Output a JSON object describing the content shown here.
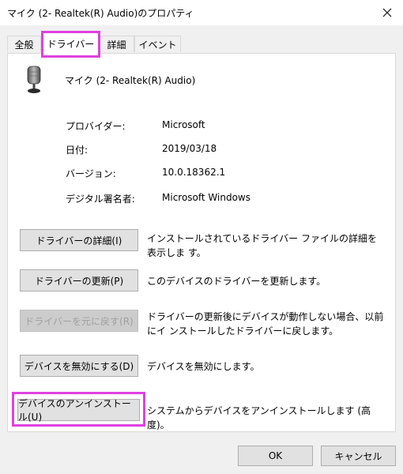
{
  "window": {
    "title": "マイク (2- Realtek(R) Audio)のプロパティ"
  },
  "tabs": [
    {
      "label": "全般"
    },
    {
      "label": "ドライバー"
    },
    {
      "label": "詳細"
    },
    {
      "label": "イベント"
    }
  ],
  "device": {
    "icon": "microphone-icon",
    "name": "マイク (2- Realtek(R) Audio)"
  },
  "properties": [
    {
      "label": "プロバイダー:",
      "value": "Microsoft"
    },
    {
      "label": "日付:",
      "value": "2019/03/18"
    },
    {
      "label": "バージョン:",
      "value": "10.0.18362.1"
    },
    {
      "label": "デジタル署名者:",
      "value": "Microsoft Windows"
    }
  ],
  "actions": [
    {
      "button": "ドライバーの詳細(I)",
      "description": "インストールされているドライバー ファイルの詳細を表示しま す。",
      "enabled": true
    },
    {
      "button": "ドライバーの更新(P)",
      "description": "このデバイスのドライバーを更新します。",
      "enabled": true
    },
    {
      "button": "ドライバーを元に戻す(R)",
      "description": "ドライバーの更新後にデバイスが動作しない場合、以前にイ ンストールしたドライバーに戻します。",
      "enabled": false
    },
    {
      "button": "デバイスを無効にする(D)",
      "description": "デバイスを無効にします。",
      "enabled": true
    },
    {
      "button": "デバイスのアンインストール(U)",
      "description": "システムからデバイスをアンインストールします (高度)。",
      "enabled": true
    }
  ],
  "footer": {
    "ok": "OK",
    "cancel": "キャンセル"
  },
  "colors": {
    "highlight": "#e040e0",
    "disabled_text": "#a0a0a0"
  }
}
